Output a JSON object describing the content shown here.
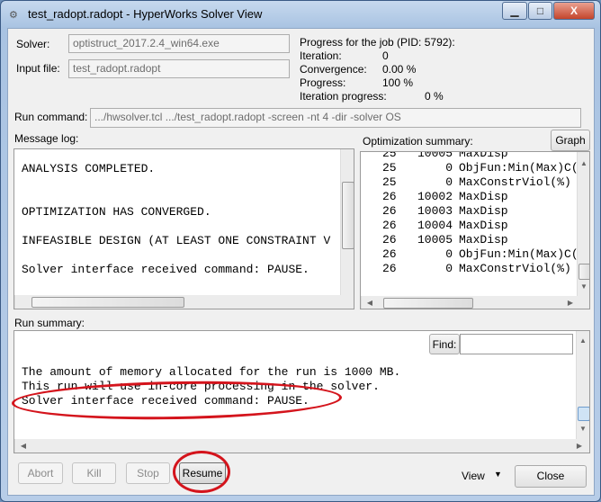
{
  "window": {
    "title": "test_radopt.radopt - HyperWorks Solver View",
    "minimize": "▁",
    "maximize": "□",
    "close": "X"
  },
  "solver": {
    "label": "Solver:",
    "value": "optistruct_2017.2.4_win64.exe"
  },
  "input_file": {
    "label": "Input file:",
    "value": "test_radopt.radopt"
  },
  "progress": {
    "header": "Progress for the job (PID: 5792):",
    "iteration_label": "Iteration:",
    "iteration": "0",
    "convergence_label": "Convergence:",
    "convergence": "0.00 %",
    "progress_label": "Progress:",
    "progress": "100 %",
    "iter_progress_label": "Iteration progress:",
    "iter_progress": "0 %"
  },
  "run_command": {
    "label": "Run command:",
    "value": ".../hwsolver.tcl .../test_radopt.radopt -screen -nt 4 -dir -solver OS"
  },
  "message_log": {
    "label": "Message log:",
    "lines": [
      "ANALYSIS COMPLETED.",
      "",
      "",
      "OPTIMIZATION HAS CONVERGED.",
      "",
      "INFEASIBLE DESIGN (AT LEAST ONE CONSTRAINT V",
      "",
      "Solver interface received command: PAUSE."
    ]
  },
  "optimization_summary": {
    "label": "Optimization summary:",
    "graph_button": "Graph",
    "rows": [
      [
        "25",
        "10005",
        "MaxDisp"
      ],
      [
        "25",
        "0",
        "ObjFun:Min(Max)C("
      ],
      [
        "25",
        "0",
        "MaxConstrViol(%)"
      ],
      [
        "26",
        "10002",
        "MaxDisp"
      ],
      [
        "26",
        "10003",
        "MaxDisp"
      ],
      [
        "26",
        "10004",
        "MaxDisp"
      ],
      [
        "26",
        "10005",
        "MaxDisp"
      ],
      [
        "26",
        "0",
        "ObjFun:Min(Max)C("
      ],
      [
        "26",
        "0",
        "MaxConstrViol(%)"
      ]
    ]
  },
  "run_summary": {
    "label": "Run summary:",
    "find_button": "Find:",
    "find_value": "",
    "lines": [
      "The amount of memory allocated for the run is 1000 MB.",
      "This run will use in-core processing in the solver.",
      "Solver interface received command: PAUSE."
    ]
  },
  "buttons": {
    "abort": "Abort",
    "kill": "Kill",
    "stop": "Stop",
    "resume": "Resume",
    "view": "View",
    "close": "Close"
  },
  "annotation_color": "#d4141c"
}
